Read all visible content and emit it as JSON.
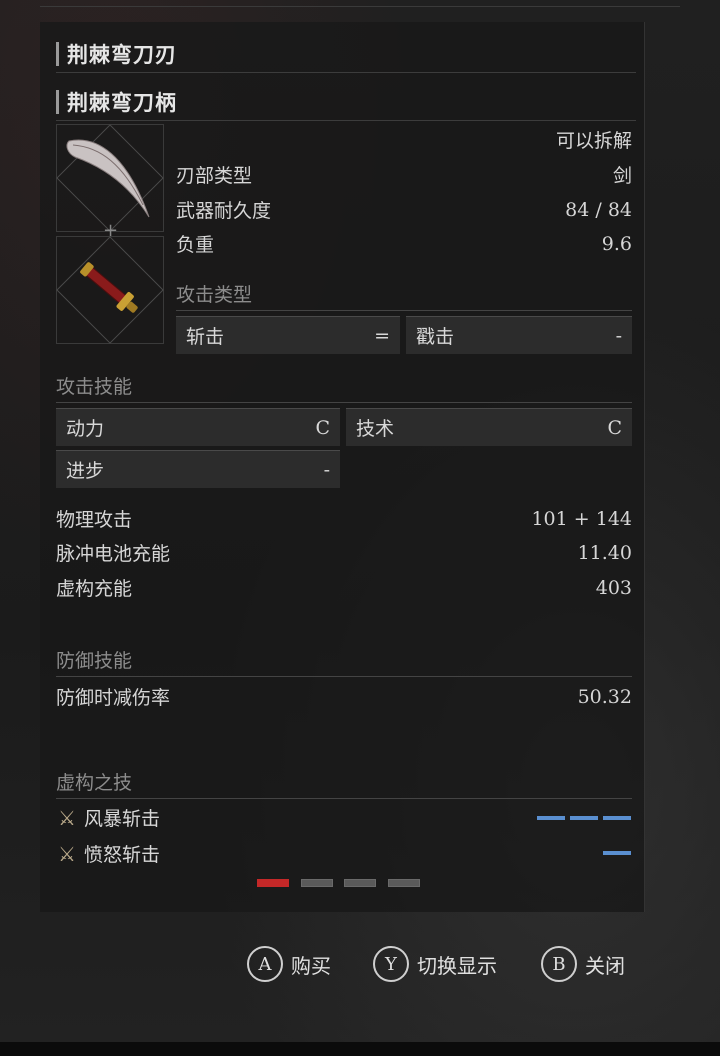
{
  "headers": {
    "blade": "荆棘弯刀刃",
    "handle": "荆棘弯刀柄"
  },
  "item_info": {
    "disassemble": "可以拆解",
    "stats": [
      {
        "label": "刃部类型",
        "value": "剑"
      },
      {
        "label": "武器耐久度",
        "value": "84 / 84"
      },
      {
        "label": "负重",
        "value": "9.6"
      }
    ]
  },
  "attack_type": {
    "title": "攻击类型",
    "slash": {
      "label": "斩击",
      "value": "="
    },
    "pierce": {
      "label": "戳击",
      "value": "-"
    }
  },
  "attack_skill": {
    "title": "攻击技能",
    "motivity": {
      "label": "动力",
      "value": "C"
    },
    "technique": {
      "label": "技术",
      "value": "C"
    },
    "advance": {
      "label": "进步",
      "value": "-"
    }
  },
  "attack_stats": [
    {
      "label": "物理攻击",
      "value": "101 + 144"
    },
    {
      "label": "脉冲电池充能",
      "value": "11.40"
    },
    {
      "label": "虚构充能",
      "value": "403"
    }
  ],
  "defense": {
    "title": "防御技能",
    "label": "防御时减伤率",
    "value": "50.32"
  },
  "fable_arts": {
    "title": "虚构之技",
    "arts": [
      {
        "name": "风暴斩击",
        "slots": 3
      },
      {
        "name": "愤怒斩击",
        "slots": 1
      }
    ]
  },
  "pagination": {
    "pages": 4,
    "active": 1
  },
  "buttons": [
    {
      "key": "A",
      "label": "购买"
    },
    {
      "key": "Y",
      "label": "切换显示"
    },
    {
      "key": "B",
      "label": "关闭"
    }
  ],
  "colors": {
    "accent_blue": "#5a8fd0",
    "page_active": "#c42828"
  }
}
